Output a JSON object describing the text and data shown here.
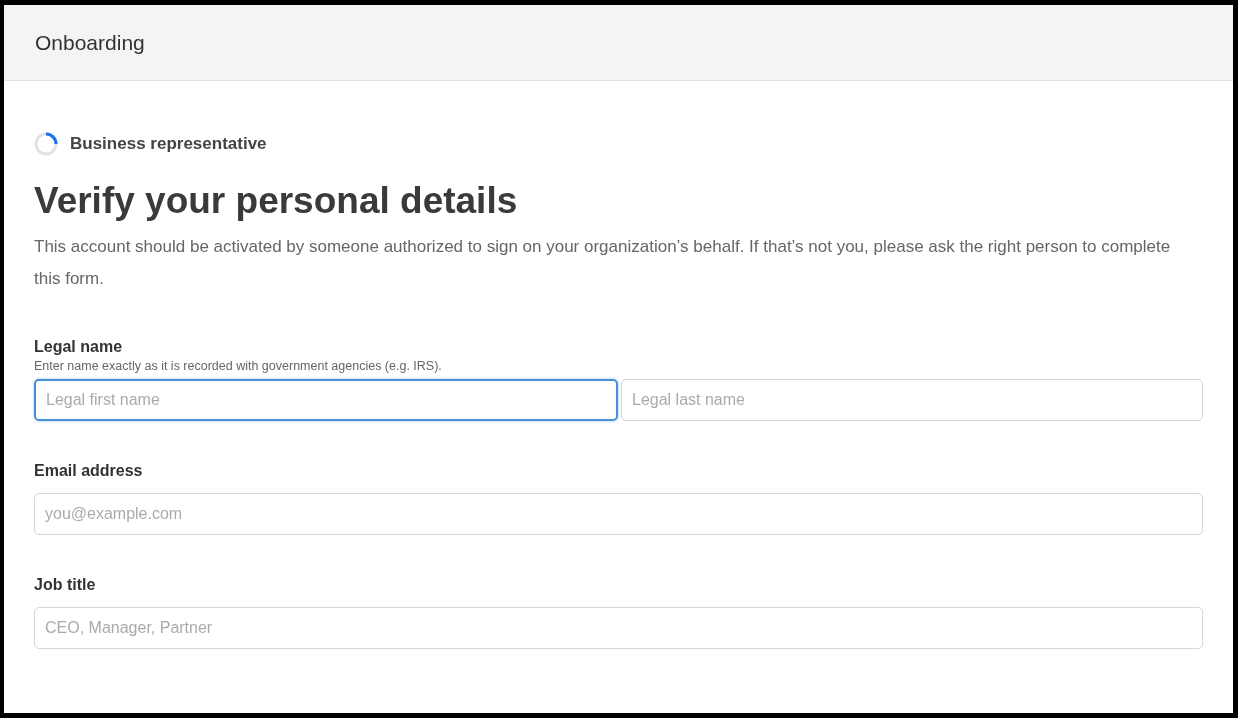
{
  "header": {
    "title": "Onboarding"
  },
  "step": {
    "label": "Business representative"
  },
  "heading": "Verify your personal details",
  "intro": "This account should be activated by someone authorized to sign on your organization’s behalf. If that’s not you, please ask the right person to complete this form.",
  "fields": [
    {
      "label": "Legal name",
      "hint": "Enter name exactly as it is recorded with government agencies (e.g. IRS).",
      "inputs": [
        {
          "placeholder": "Legal first name",
          "focused": true
        },
        {
          "placeholder": "Legal last name",
          "focused": false
        }
      ]
    },
    {
      "label": "Email address",
      "inputs": [
        {
          "placeholder": "you@example.com",
          "focused": false
        }
      ]
    },
    {
      "label": "Job title",
      "inputs": [
        {
          "placeholder": "CEO, Manager, Partner",
          "focused": false
        }
      ]
    }
  ]
}
